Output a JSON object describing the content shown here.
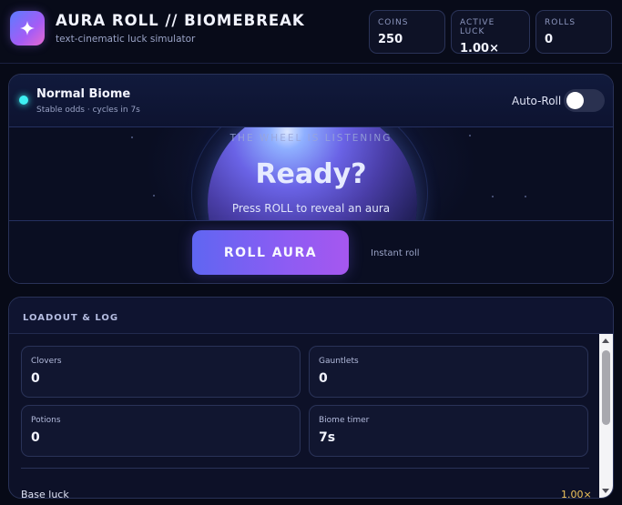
{
  "header": {
    "title": "AURA ROLL // BIOMEBREAK",
    "subtitle": "text-cinematic luck simulator",
    "logo_icon": "sparkle-icon",
    "stats": [
      {
        "label": "COINS",
        "value": "250"
      },
      {
        "label": "ACTIVE LUCK",
        "value": "1.00×"
      },
      {
        "label": "ROLLS",
        "value": "0"
      }
    ]
  },
  "biome": {
    "name": "Normal Biome",
    "description": "Stable odds · cycles in 7s",
    "indicator_color": "#3ef0f2",
    "autoroll_label": "Auto-Roll",
    "autoroll_on": false
  },
  "stage": {
    "caption": "THE WHEEL IS LISTENING",
    "headline": "Ready?",
    "hint": "Press ROLL to reveal an aura"
  },
  "actions": {
    "roll_label": "ROLL AURA",
    "roll_hint": "Instant roll"
  },
  "loadout": {
    "title": "LOADOUT & LOG",
    "cards": [
      {
        "label": "Clovers",
        "value": "0"
      },
      {
        "label": "Gauntlets",
        "value": "0"
      },
      {
        "label": "Potions",
        "value": "0"
      },
      {
        "label": "Biome timer",
        "value": "7s"
      }
    ],
    "rows": [
      {
        "label": "Base luck",
        "value": "1.00×"
      }
    ]
  },
  "colors": {
    "accent": "#8d5cf3",
    "background": "#070a17",
    "luck_value": "#f0c45a"
  }
}
